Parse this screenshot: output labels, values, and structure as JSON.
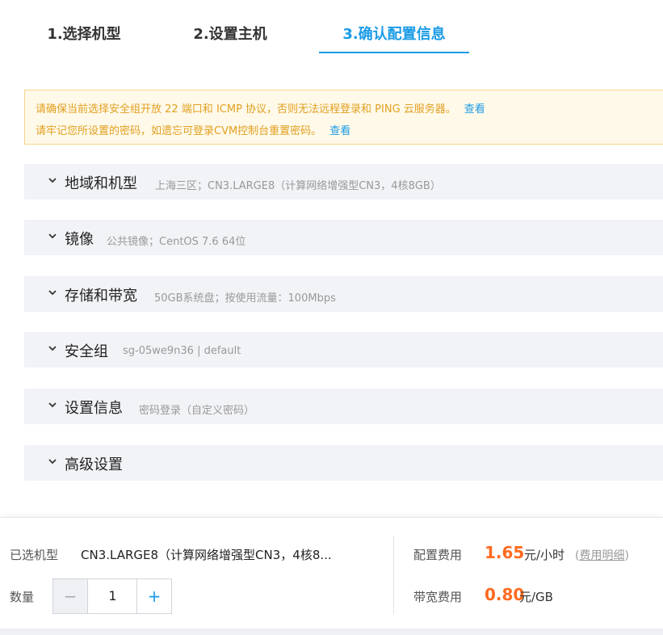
{
  "steps": [
    {
      "label": "1.选择机型"
    },
    {
      "label": "2.设置主机"
    },
    {
      "label": "3.确认配置信息"
    }
  ],
  "notice": {
    "line1": "请确保当前选择安全组开放 22 端口和 ICMP 协议，否则无法远程登录和 PING 云服务器。",
    "line1_link": "查看",
    "line2": "请牢记您所设置的密码，如遗忘可登录CVM控制台重置密码。",
    "line2_link": "查看"
  },
  "sections": [
    {
      "title": "地域和机型",
      "summary": "上海三区；CN3.LARGE8（计算网络增强型CN3，4核8GB）"
    },
    {
      "title": "镜像",
      "summary": "公共镜像；CentOS 7.6 64位"
    },
    {
      "title": "存储和带宽",
      "summary": "50GB系统盘；按使用流量：100Mbps"
    },
    {
      "title": "安全组",
      "summary": "sg-05we9n36 | default"
    },
    {
      "title": "设置信息",
      "summary": "密码登录（自定义密码）"
    },
    {
      "title": "高级设置",
      "summary": ""
    }
  ],
  "footer": {
    "selected_label": "已选机型",
    "selected_value": "CN3.LARGE8（计算网络增强型CN3，4核8...",
    "qty_label": "数量",
    "qty_value": "1",
    "minus": "−",
    "plus": "+",
    "config_fee_label": "配置费用",
    "config_fee_value": "1.65",
    "config_fee_unit": "元/小时",
    "fee_detail_open": "(",
    "fee_detail": "费用明细",
    "fee_detail_close": ")",
    "bandwidth_fee_label": "带宽费用",
    "bandwidth_fee_value": "0.80",
    "bandwidth_fee_unit": "元/GB"
  },
  "colors": {
    "accent": "#1a9be6",
    "price": "#ff6a1f",
    "warning_text": "#e0a020",
    "warning_bg": "#fff9e9"
  }
}
